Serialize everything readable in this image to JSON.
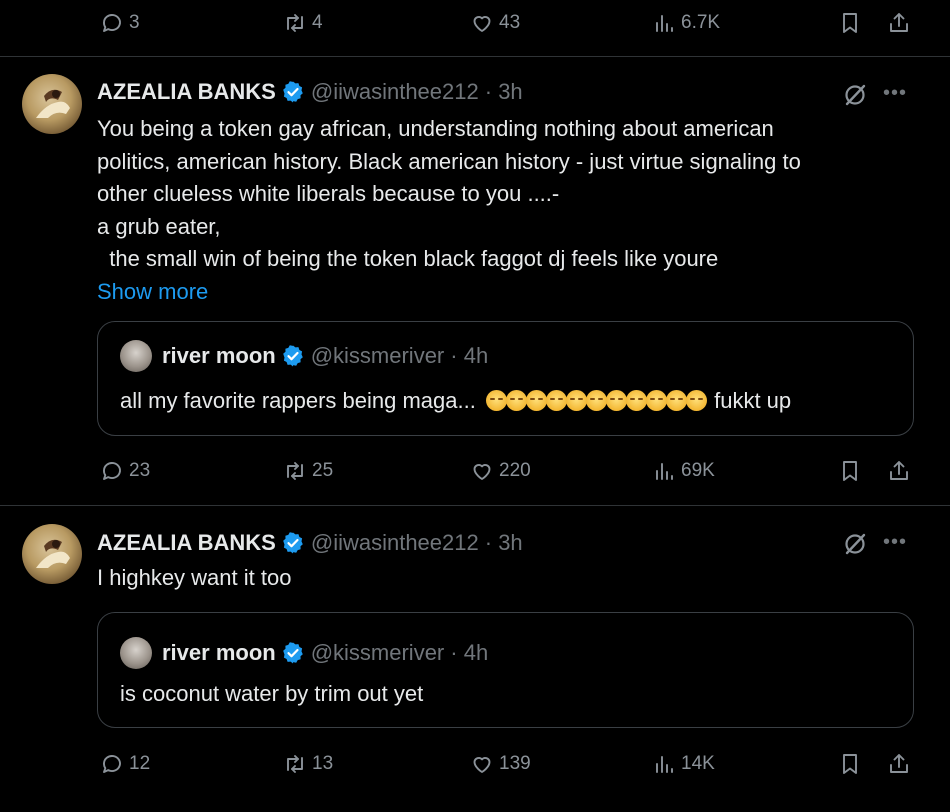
{
  "top_actions": {
    "replies": "3",
    "reposts": "4",
    "likes": "43",
    "views": "6.7K"
  },
  "tweet1": {
    "name": "AZEALIA BANKS",
    "handle": "@iiwasinthee212",
    "time": "· 3h",
    "lines": [
      "You being a token gay african, understanding nothing about american",
      "politics, american history. Black american history - just virtue signaling to",
      "other clueless white liberals because to you ....-",
      "a grub eater,",
      "  the small win of being the token black faggot dj feels like youre"
    ],
    "show_more": "Show more",
    "quote": {
      "name": "river moon",
      "handle": "@kissmeriver",
      "time": "· 4h",
      "text_before": "all my favorite rappers being maga...",
      "emoji_name": "pleading-face",
      "emoji_count": 11,
      "text_after": "fukkt up"
    },
    "actions": {
      "replies": "23",
      "reposts": "25",
      "likes": "220",
      "views": "69K"
    }
  },
  "tweet2": {
    "name": "AZEALIA BANKS",
    "handle": "@iiwasinthee212",
    "time": "· 3h",
    "text": "I highkey want it too",
    "quote": {
      "name": "river moon",
      "handle": "@kissmeriver",
      "time": "· 4h",
      "text": "is coconut water by trim out yet"
    },
    "actions": {
      "replies": "12",
      "reposts": "13",
      "likes": "139",
      "views": "14K"
    }
  },
  "icons": {
    "reply": "reply-icon",
    "repost": "repost-icon",
    "like": "heart-icon",
    "views": "views-icon",
    "bookmark": "bookmark-icon",
    "share": "share-icon",
    "grok": "grok-icon",
    "more": "more-icon",
    "verified": "verified-badge-icon"
  },
  "colors": {
    "background": "#000000",
    "text": "#e7e9ea",
    "muted": "#71767b",
    "link": "#1d9bf0",
    "verified": "#1d9bf0",
    "divider": "#2f3336"
  }
}
